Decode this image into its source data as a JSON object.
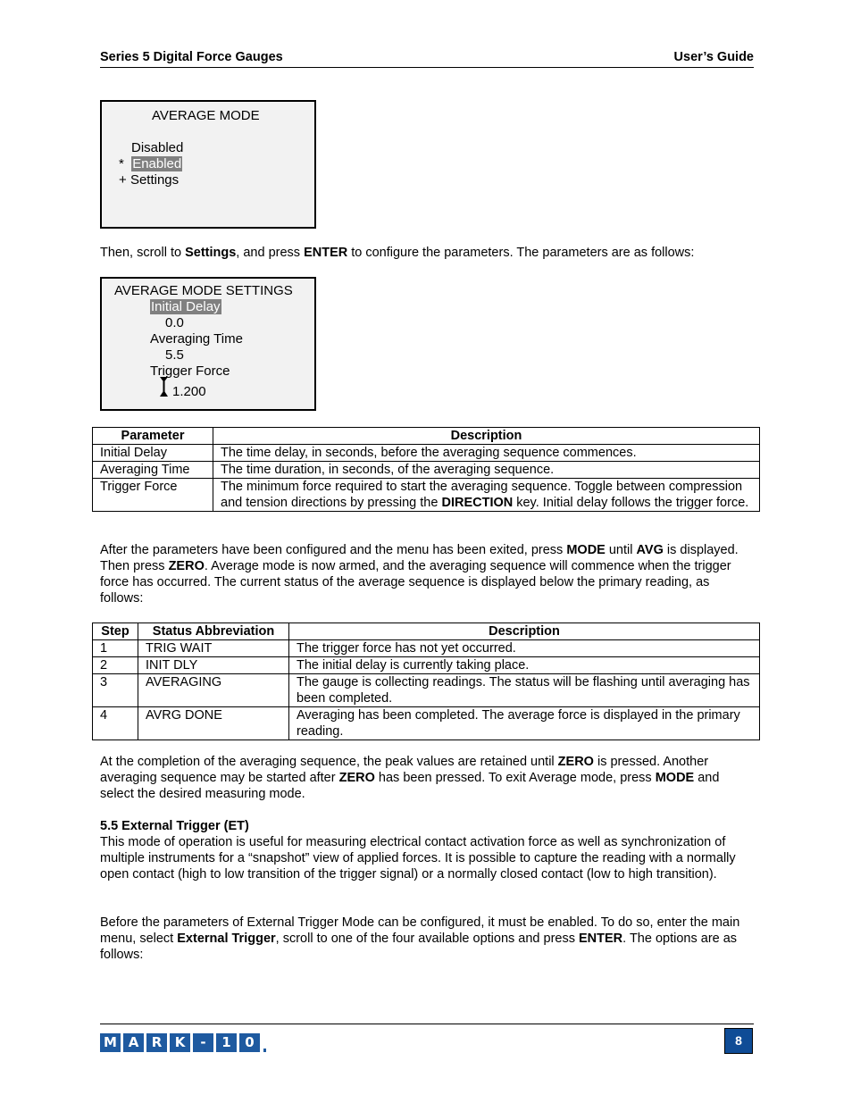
{
  "header": {
    "left_title": "Series 5 Digital Force Gauges",
    "right_title": "User’s Guide"
  },
  "avg_mode_screen": {
    "title": "AVERAGE MODE",
    "options": [
      {
        "marker": "",
        "label": "Disabled",
        "selected": false
      },
      {
        "marker": "*",
        "label": "Enabled",
        "selected": true
      },
      {
        "marker": "+",
        "label": "Settings",
        "selected": false
      }
    ]
  },
  "para_settings": {
    "t1": "Then, scroll to ",
    "b1": "Settings",
    "t2": ", and press ",
    "b2": "ENTER",
    "t3": " to configure the parameters. The parameters are as follows:"
  },
  "avg_settings_screen": {
    "title": "AVERAGE MODE SETTINGS",
    "items": [
      {
        "label": "Initial Delay",
        "value": "0.0",
        "selected": true
      },
      {
        "label": "Averaging Time",
        "value": "5.5",
        "selected": false
      },
      {
        "label": "Trigger Force",
        "value": "1.200",
        "selected": false,
        "direction_icon": "up-down-arrows-icon"
      }
    ]
  },
  "param_table": {
    "headers": [
      "Parameter",
      "Description"
    ],
    "rows": [
      {
        "param": "Initial Delay",
        "desc": "The time delay, in seconds, before the averaging sequence commences."
      },
      {
        "param": "Averaging Time",
        "desc": "The time duration, in seconds, of the averaging sequence."
      },
      {
        "param": "Trigger Force",
        "desc_t1": "The minimum force required to start the averaging sequence. Toggle between compression and tension directions by pressing the ",
        "desc_b1": "DIRECTION",
        "desc_t2": " key. Initial delay follows the trigger force."
      }
    ]
  },
  "para_after": {
    "t1": "After the parameters have been configured and the menu has been exited, press ",
    "b1": "MODE",
    "t2": " until ",
    "b2": "AVG",
    "t3": " is displayed. Then press ",
    "b3": "ZERO",
    "t4": ". Average mode is now armed, and the averaging sequence will commence when the trigger force has occurred. The current status of the average sequence is displayed below the primary reading, as follows:"
  },
  "status_table": {
    "headers": [
      "Step",
      "Status Abbreviation",
      "Description"
    ],
    "rows": [
      {
        "step": "1",
        "abbr": "TRIG WAIT",
        "desc": "The trigger force has not yet occurred."
      },
      {
        "step": "2",
        "abbr": "INIT DLY",
        "desc": "The initial delay is currently taking place."
      },
      {
        "step": "3",
        "abbr": "AVERAGING",
        "desc": "The gauge is collecting readings. The status will be flashing until averaging has been completed."
      },
      {
        "step": "4",
        "abbr": "AVRG DONE",
        "desc": "Averaging has been completed. The average force is displayed in the primary reading."
      }
    ]
  },
  "para_completion": {
    "t1": "At the completion of the averaging sequence, the peak values are retained until ",
    "b1": "ZERO",
    "t2": " is pressed. Another averaging sequence may be started after ",
    "b2": "ZERO",
    "t3": " has been pressed. To exit Average mode, press ",
    "b3": "MODE",
    "t4": " and select the desired measuring mode."
  },
  "section_ext_trigger": {
    "heading": "5.5 External Trigger (ET)",
    "body": "This mode of operation is useful for measuring electrical contact activation force as well as synchronization of multiple instruments for a “snapshot” view of applied forces. It is possible to capture the reading with a normally open contact (high to low transition of the trigger signal) or a normally closed contact (low to high transition)."
  },
  "para_before": {
    "t1": "Before the parameters of External Trigger Mode can be configured, it must be enabled. To do so, enter the main menu, select ",
    "b1": "External Trigger",
    "t2": ", scroll to one of the four available options and press ",
    "b2": "ENTER",
    "t3": ". The options are as follows:"
  },
  "footer": {
    "logo_letters": [
      "M",
      "A",
      "R",
      "K",
      "-",
      "1",
      "0"
    ],
    "page_number": "8"
  },
  "colors": {
    "logo_blue": "#1e5aa0",
    "page_badge_blue": "#0f4c96",
    "lcd_background": "#f2f2f2",
    "lcd_highlight": "#808080"
  }
}
